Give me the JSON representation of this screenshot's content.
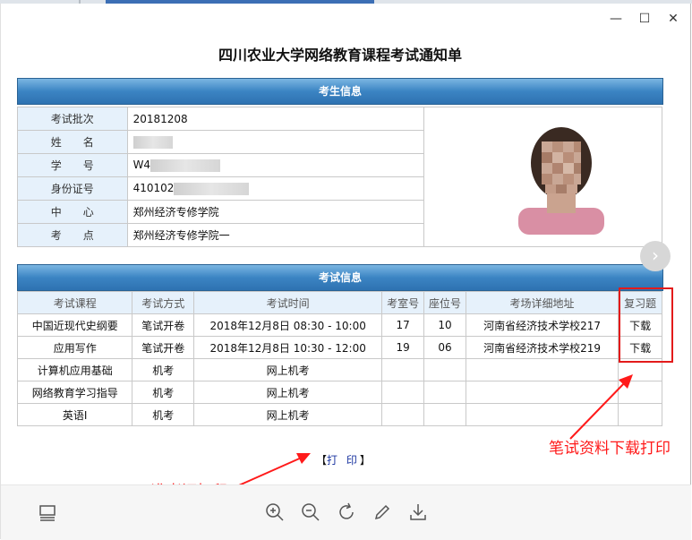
{
  "window": {
    "minimize": "—",
    "maximize": "☐",
    "close": "✕"
  },
  "title": "四川农业大学网络教育课程考试通知单",
  "student_section": {
    "header": "考生信息",
    "rows": [
      {
        "label": "考试批次",
        "value": "20181208"
      },
      {
        "label": "姓　　名",
        "value": ""
      },
      {
        "label": "学　　号",
        "value": "W4"
      },
      {
        "label": "身份证号",
        "value": "410102"
      },
      {
        "label": "中　　心",
        "value": "郑州经济专修学院"
      },
      {
        "label": "考　　点",
        "value": "郑州经济专修学院一"
      }
    ]
  },
  "exam_section": {
    "header": "考试信息",
    "columns": [
      "考试课程",
      "考试方式",
      "考试时间",
      "考室号",
      "座位号",
      "考场详细地址",
      "复习题"
    ],
    "rows": [
      [
        "中国近现代史纲要",
        "笔试开卷",
        "2018年12月8日 08:30 - 10:00",
        "17",
        "10",
        "河南省经济技术学校217",
        "下载"
      ],
      [
        "应用写作",
        "笔试开卷",
        "2018年12月8日 10:30 - 12:00",
        "19",
        "06",
        "河南省经济技术学校219",
        "下载"
      ],
      [
        "计算机应用基础",
        "机考",
        "网上机考",
        "",
        "",
        "",
        ""
      ],
      [
        "网络教育学习指导",
        "机考",
        "网上机考",
        "",
        "",
        "",
        ""
      ],
      [
        "英语Ⅰ",
        "机考",
        "网上机考",
        "",
        "",
        "",
        ""
      ]
    ]
  },
  "print": {
    "open": "【",
    "label": "打 印",
    "close": "】"
  },
  "annotations": {
    "written": "笔试资料下载打印",
    "admission": "准考证打印",
    "color": "#ff1a1a"
  },
  "nav": {
    "next": "›"
  }
}
